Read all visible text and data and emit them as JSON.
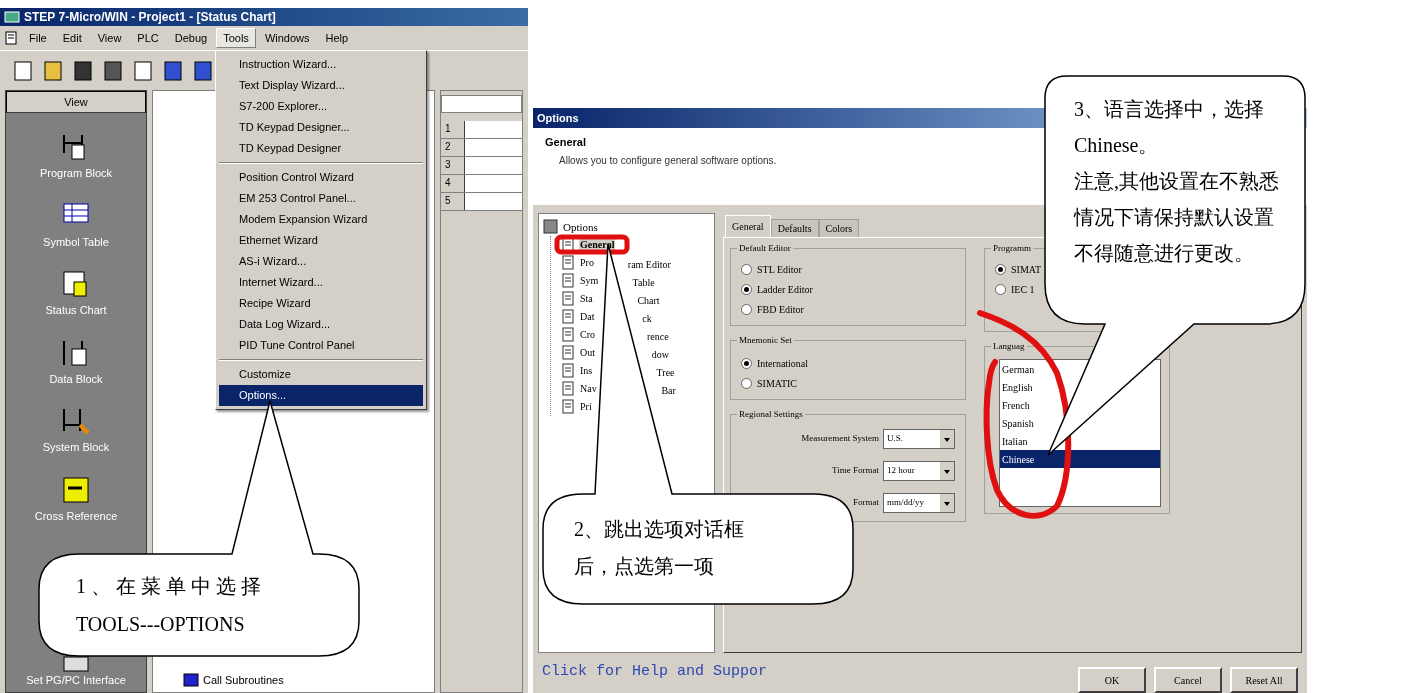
{
  "main_window": {
    "title": "STEP 7-Micro/WIN - Project1 - [Status Chart]",
    "menu": [
      {
        "label": "File",
        "selected": false
      },
      {
        "label": "Edit",
        "selected": false
      },
      {
        "label": "View",
        "selected": false
      },
      {
        "label": "PLC",
        "selected": false
      },
      {
        "label": "Debug",
        "selected": false
      },
      {
        "label": "Tools",
        "selected": true
      },
      {
        "label": "Windows",
        "selected": false
      },
      {
        "label": "Help",
        "selected": false
      }
    ],
    "navigation_bar": {
      "header": "View",
      "items": [
        {
          "label": "Program Block"
        },
        {
          "label": "Symbol Table"
        },
        {
          "label": "Status Chart"
        },
        {
          "label": "Data Block"
        },
        {
          "label": "System Block"
        },
        {
          "label": "Cross Reference"
        }
      ],
      "bottom_item": "Set PG/PC Interface"
    },
    "tree_bottom_item": "Call Subroutines",
    "status_chart_rows": [
      "1",
      "2",
      "3",
      "4",
      "5"
    ],
    "tools_menu": [
      {
        "label": "Instruction Wizard...",
        "selected": false,
        "separator_after": false
      },
      {
        "label": "Text Display Wizard...",
        "selected": false,
        "separator_after": false
      },
      {
        "label": "S7-200 Explorer...",
        "selected": false,
        "separator_after": false
      },
      {
        "label": "TD Keypad Designer...",
        "selected": false,
        "separator_after": false
      },
      {
        "label": "TD Keypad Designer",
        "selected": false,
        "separator_after": true
      },
      {
        "label": "Position Control Wizard",
        "selected": false,
        "separator_after": false
      },
      {
        "label": "EM 253 Control Panel...",
        "selected": false,
        "separator_after": false
      },
      {
        "label": "Modem Expansion Wizard",
        "selected": false,
        "separator_after": false
      },
      {
        "label": "Ethernet Wizard",
        "selected": false,
        "separator_after": false
      },
      {
        "label": "AS-i Wizard...",
        "selected": false,
        "separator_after": false
      },
      {
        "label": "Internet Wizard...",
        "selected": false,
        "separator_after": false
      },
      {
        "label": "Recipe Wizard",
        "selected": false,
        "separator_after": false
      },
      {
        "label": "Data Log Wizard...",
        "selected": false,
        "separator_after": false
      },
      {
        "label": "PID Tune Control Panel",
        "selected": false,
        "separator_after": true
      },
      {
        "label": "Customize",
        "selected": false,
        "separator_after": false
      },
      {
        "label": "Options...",
        "selected": true,
        "separator_after": false
      }
    ]
  },
  "options_dialog": {
    "title": "Options",
    "header": "General",
    "description": "Allows you to configure general software options.",
    "tree": {
      "label": "Options",
      "children": [
        {
          "label": "General",
          "selected": true
        },
        {
          "label": "Pro",
          "label_2": "ram Editor",
          "selected": false
        },
        {
          "label": "Sym",
          "label_2": "Table",
          "selected": false
        },
        {
          "label": "Sta",
          "label_2": "Chart",
          "selected": false
        },
        {
          "label": "Dat",
          "label_2": "ck",
          "selected": false
        },
        {
          "label": "Cro",
          "label_2": "rence",
          "selected": false
        },
        {
          "label": "Out",
          "label_2": "dow",
          "selected": false
        },
        {
          "label": "Ins",
          "label_2": "Tree",
          "selected": false
        },
        {
          "label": "Nav",
          "label_2": "Bar",
          "selected": false
        },
        {
          "label": "Pri",
          "selected": false
        }
      ]
    },
    "tabs": [
      {
        "label": "General",
        "selected": true
      },
      {
        "label": "Defaults",
        "selected": false
      },
      {
        "label": "Colors",
        "selected": false
      }
    ],
    "default_editor": {
      "label": "Default Editor",
      "options": [
        {
          "label": "STL Editor",
          "selected": false
        },
        {
          "label": "Ladder Editor",
          "selected": true
        },
        {
          "label": "FBD Editor",
          "selected": false
        }
      ]
    },
    "mnemonic_set": {
      "label": "Mnemonic Set",
      "options": [
        {
          "label": "International",
          "selected": true
        },
        {
          "label": "SIMATIC",
          "selected": false
        }
      ]
    },
    "regional_settings": {
      "label": "Regional Settings",
      "fields": [
        {
          "label": "Measurement System",
          "value": "U.S."
        },
        {
          "label": "Time Format",
          "value": "12 hour"
        },
        {
          "label": "Format",
          "value": "mm/dd/yy"
        }
      ]
    },
    "programming_style": {
      "label": "Programm",
      "options": [
        {
          "label": "SIMAT",
          "selected": true
        },
        {
          "label": "IEC 1",
          "selected": false
        }
      ]
    },
    "language": {
      "label": "Languag",
      "items": [
        {
          "label": "German",
          "selected": false
        },
        {
          "label": "English",
          "selected": false
        },
        {
          "label": "French",
          "selected": false
        },
        {
          "label": "Spanish",
          "selected": false
        },
        {
          "label": "Italian",
          "selected": false
        },
        {
          "label": "Chinese",
          "selected": true
        }
      ]
    },
    "help_link": "Click for Help and Suppor",
    "buttons": [
      "OK",
      "Cancel",
      "Reset All"
    ]
  },
  "callouts": [
    {
      "lines": [
        "1 、 在 菜 单 中 选 择",
        "TOOLS---OPTIONS"
      ]
    },
    {
      "lines": [
        "2、跳出选项对话框",
        "后，点选第一项"
      ]
    },
    {
      "lines": [
        "3、语言选择中，选择",
        "Chinese。",
        "注意,其他设置在不熟悉",
        "情况下请保持默认设置",
        "不得随意进行更改。"
      ]
    }
  ]
}
